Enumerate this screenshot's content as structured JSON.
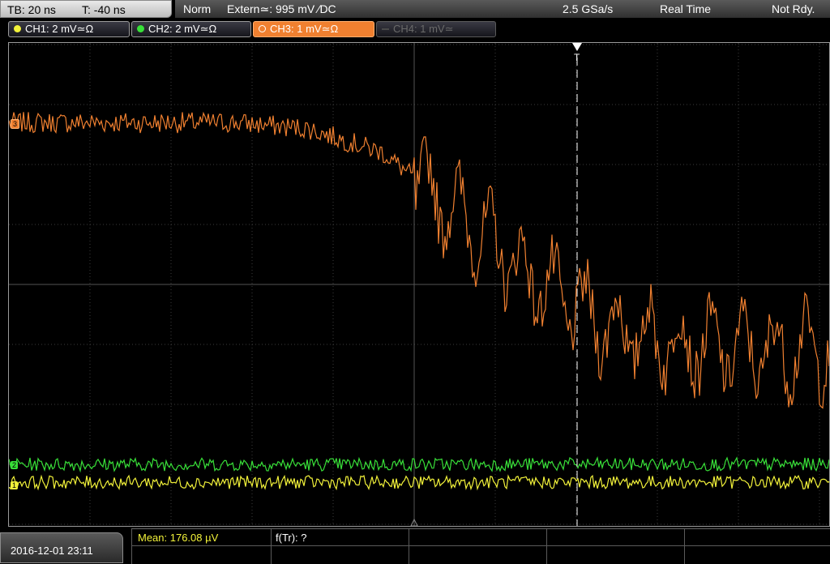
{
  "timebase": {
    "tb_label": "TB: 20 ns",
    "t_label": "T: -40 ns"
  },
  "status": {
    "mode": "Norm",
    "trigger": "Extern≃: 995 mV ∕DC",
    "sample_rate": "2.5 GSa/s",
    "acq_mode": "Real Time",
    "state": "Not Rdy."
  },
  "channels": [
    {
      "label": "CH1: 2 mV≃Ω",
      "color": "#f2f23a",
      "active": false,
      "enabled": true
    },
    {
      "label": "CH2: 2 mV≃Ω",
      "color": "#38e038",
      "active": false,
      "enabled": true
    },
    {
      "label": "CH3: 1 mV≃Ω",
      "color": "#f08030",
      "active": true,
      "enabled": true
    },
    {
      "label": "CH4: 1 mV≃",
      "color": "#6a6a6a",
      "active": false,
      "enabled": false
    }
  ],
  "trigger_marker": {
    "label": "T"
  },
  "measurements": {
    "mean": "Mean: 176.08 µV",
    "ftr": "f(Tr): ?"
  },
  "datetime": "2016-12-01 23:11",
  "colors": {
    "ch1": "#f2f23a",
    "ch2": "#38e038",
    "ch3": "#f08030",
    "grid": "#3c3c3c",
    "trigger_line": "#ffffff"
  },
  "chart_data": {
    "type": "line",
    "title": "",
    "xlabel": "",
    "ylabel": "",
    "grid": true,
    "series": [
      {
        "name": "CH3",
        "description_level_divs": [
          2.7,
          2.7,
          2.7,
          2.7,
          2.6,
          2.2,
          1.2,
          0.1,
          -0.7,
          -1.0,
          -1.1,
          -1.1
        ]
      },
      {
        "name": "CH2",
        "description_level_divs": [
          -3.0,
          -3.0,
          -3.0,
          -3.0,
          -3.0,
          -3.0,
          -3.0,
          -3.0,
          -3.0,
          -3.0,
          -3.0,
          -3.0
        ]
      },
      {
        "name": "CH1",
        "description_level_divs": [
          -3.3,
          -3.3,
          -3.3,
          -3.3,
          -3.3,
          -3.3,
          -3.3,
          -3.3,
          -3.3,
          -3.3,
          -3.3,
          -3.3
        ]
      }
    ]
  }
}
